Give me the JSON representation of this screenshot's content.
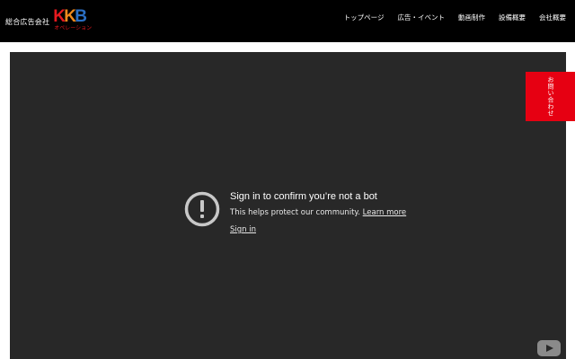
{
  "header": {
    "company_prefix": "総合広告会社",
    "logo": {
      "letters": [
        "K",
        "K",
        "B"
      ],
      "subtitle": "オペレーション",
      "colors": [
        "#e6191f",
        "#f08a1c",
        "#2b6fc3"
      ]
    },
    "nav": [
      {
        "label": "トップページ"
      },
      {
        "label": "広告・イベント"
      },
      {
        "label": "動画制作"
      },
      {
        "label": "設備概要"
      },
      {
        "label": "会社概要"
      }
    ]
  },
  "contact_tab": {
    "label": "お問い合わせ",
    "color": "#e60012"
  },
  "video": {
    "error_title": "Sign in to confirm you’re not a bot",
    "error_description": "This helps protect our community.",
    "learn_more": "Learn more",
    "sign_in": "Sign in",
    "icon": "alert-circle-icon",
    "brand_icon": "youtube-icon"
  }
}
